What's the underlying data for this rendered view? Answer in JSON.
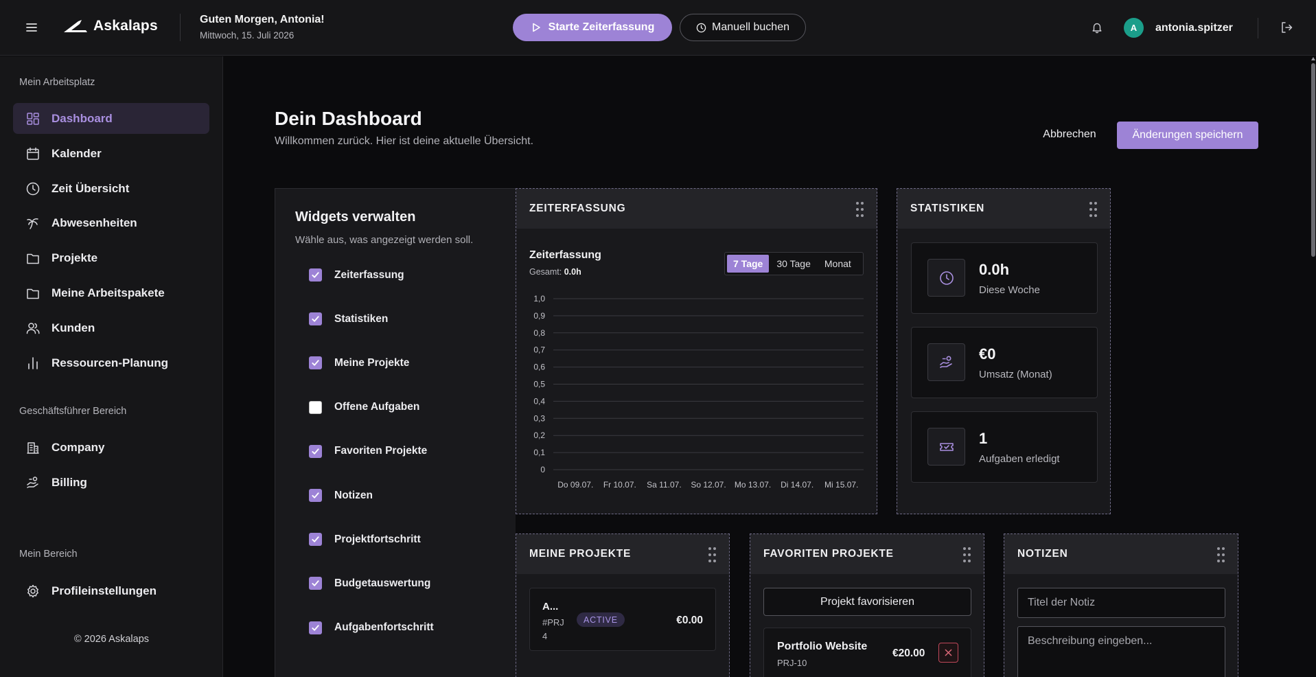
{
  "header": {
    "brand": "Askalaps",
    "greeting": "Guten Morgen, Antonia!",
    "date": "Mittwoch, 15. Juli 2026",
    "start_label": "Starte Zeiterfassung",
    "manual_label": "Manuell buchen",
    "avatar_initial": "A",
    "username": "antonia.spitzer"
  },
  "sidebar": {
    "section_workspace": "Mein Arbeitsplatz",
    "items": [
      {
        "label": "Dashboard",
        "icon": "dashboard-icon"
      },
      {
        "label": "Kalender",
        "icon": "calendar-icon"
      },
      {
        "label": "Zeit Übersicht",
        "icon": "clock-icon"
      },
      {
        "label": "Abwesenheiten",
        "icon": "palm-tree-icon"
      },
      {
        "label": "Projekte",
        "icon": "folder-icon"
      },
      {
        "label": "Meine Arbeitspakete",
        "icon": "folder-icon"
      },
      {
        "label": "Kunden",
        "icon": "users-icon"
      },
      {
        "label": "Ressourcen-Planung",
        "icon": "bar-chart-icon"
      }
    ],
    "section_manager": "Geschäftsführer Bereich",
    "manager_items": [
      {
        "label": "Company",
        "icon": "building-icon"
      },
      {
        "label": "Billing",
        "icon": "billing-hand-icon"
      }
    ],
    "section_personal": "Mein Bereich",
    "personal_items": [
      {
        "label": "Profileinstellungen",
        "icon": "gear-icon"
      }
    ],
    "footer": "© 2026 Askalaps"
  },
  "main": {
    "title": "Dein Dashboard",
    "subtitle": "Willkommen zurück. Hier ist deine aktuelle Übersicht.",
    "cancel_label": "Abbrechen",
    "save_label": "Änderungen speichern"
  },
  "widgets": {
    "title": "Widgets verwalten",
    "subtitle": "Wähle aus, was angezeigt werden soll.",
    "items": [
      {
        "label": "Zeiterfassung",
        "checked": true
      },
      {
        "label": "Statistiken",
        "checked": true
      },
      {
        "label": "Meine Projekte",
        "checked": true
      },
      {
        "label": "Offene Aufgaben",
        "checked": false
      },
      {
        "label": "Favoriten Projekte",
        "checked": true
      },
      {
        "label": "Notizen",
        "checked": true
      },
      {
        "label": "Projektfortschritt",
        "checked": true
      },
      {
        "label": "Budgetauswertung",
        "checked": true
      },
      {
        "label": "Aufgabenfortschritt",
        "checked": true
      }
    ]
  },
  "time_card": {
    "header": "ZEITERFASSUNG",
    "label": "Zeiterfassung",
    "total_prefix": "Gesamt:",
    "total_value": "0.0h",
    "ranges": [
      "7 Tage",
      "30 Tage",
      "Monat"
    ],
    "active_range": "7 Tage"
  },
  "chart_data": {
    "type": "bar",
    "categories": [
      "Do 09.07.",
      "Fr 10.07.",
      "Sa 11.07.",
      "So 12.07.",
      "Mo 13.07.",
      "Di 14.07.",
      "Mi 15.07."
    ],
    "values": [
      0,
      0,
      0,
      0,
      0,
      0,
      0
    ],
    "y_ticks": [
      "0",
      "0,1",
      "0,2",
      "0,3",
      "0,4",
      "0,5",
      "0,6",
      "0,7",
      "0,8",
      "0,9",
      "1,0"
    ],
    "ylim": [
      0,
      1
    ],
    "grid": true,
    "title": "",
    "xlabel": "",
    "ylabel": ""
  },
  "stats_card": {
    "header": "STATISTIKEN",
    "items": [
      {
        "value": "0.0h",
        "label": "Diese Woche",
        "icon": "clock-icon"
      },
      {
        "value": "€0",
        "label": "Umsatz (Monat)",
        "icon": "revenue-hand-icon"
      },
      {
        "value": "1",
        "label": "Aufgaben erledigt",
        "icon": "ticket-check-icon"
      }
    ]
  },
  "projects_card": {
    "header": "MEINE PROJEKTE",
    "project": {
      "name": "A...",
      "id": "#PRJ 4",
      "status": "ACTIVE",
      "amount": "€0.00"
    }
  },
  "favorites_card": {
    "header": "FAVORITEN PROJEKTE",
    "button_label": "Projekt favorisieren",
    "project": {
      "name": "Portfolio Website",
      "id": "PRJ-10",
      "amount": "€20.00"
    }
  },
  "notes_card": {
    "header": "NOTIZEN",
    "title_placeholder": "Titel der Notiz",
    "desc_placeholder": "Beschreibung eingeben..."
  },
  "colors": {
    "accent": "#9d83d6",
    "active_bg": "#2a2536",
    "avatar": "#1b9e8a",
    "danger": "#c0485a"
  }
}
